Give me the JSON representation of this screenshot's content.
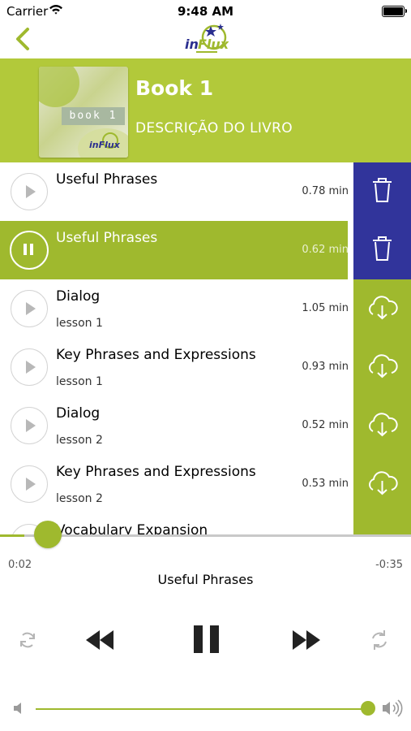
{
  "status_bar": {
    "carrier": "Carrier",
    "time": "9:48 AM"
  },
  "nav": {
    "back_icon": "chevron-left-icon",
    "logo_icon": "influx-logo"
  },
  "book": {
    "title": "Book 1",
    "description": "DESCRIÇÃO DO LIVRO",
    "cover_label": "book 1"
  },
  "colors": {
    "accent": "#9fb92e",
    "header": "#b2c93a",
    "delete_action": "#31349b"
  },
  "tracks": [
    {
      "title": "Useful Phrases",
      "subtitle": "",
      "duration": "0.78 min",
      "state": "stopped",
      "action": "delete"
    },
    {
      "title": "Useful Phrases",
      "subtitle": "",
      "duration": "0.62 min",
      "state": "playing",
      "action": "delete"
    },
    {
      "title": "Dialog",
      "subtitle": "lesson 1",
      "duration": "1.05 min",
      "state": "stopped",
      "action": "download"
    },
    {
      "title": "Key Phrases and Expressions",
      "subtitle": "lesson 1",
      "duration": "0.93 min",
      "state": "stopped",
      "action": "download"
    },
    {
      "title": "Dialog",
      "subtitle": "lesson 2",
      "duration": "0.52 min",
      "state": "stopped",
      "action": "download"
    },
    {
      "title": "Key Phrases and Expressions",
      "subtitle": "lesson 2",
      "duration": "0.53 min",
      "state": "stopped",
      "action": "download"
    },
    {
      "title": "Vocabulary Expansion",
      "subtitle": "",
      "duration": "",
      "state": "stopped",
      "action": "download"
    }
  ],
  "player": {
    "elapsed": "0:02",
    "remaining": "-0:35",
    "now_playing": "Useful Phrases",
    "progress_fraction": 0.06,
    "volume_fraction": 1.0,
    "controls": [
      "repeat-icon",
      "rewind-icon",
      "pause-icon",
      "fast-forward-icon",
      "shuffle-icon"
    ]
  }
}
